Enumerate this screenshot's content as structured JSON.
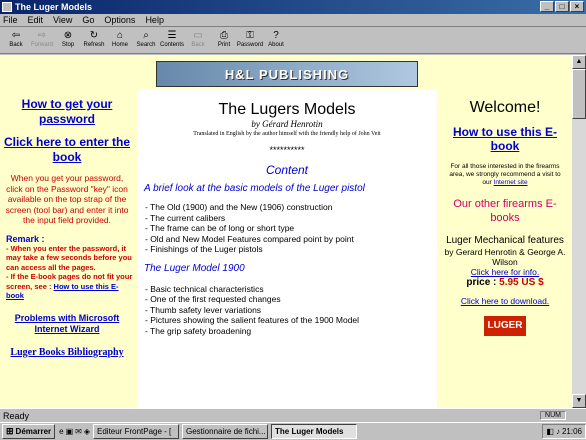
{
  "window": {
    "title": "The Luger Models"
  },
  "menu": [
    "File",
    "Edit",
    "View",
    "Go",
    "Options",
    "Help"
  ],
  "toolbar": [
    {
      "label": "Back",
      "icon": "back-icon",
      "glyph": "⇦",
      "enabled": true
    },
    {
      "label": "Forward",
      "icon": "forward-icon",
      "glyph": "⇨",
      "enabled": false
    },
    {
      "label": "Stop",
      "icon": "stop-icon",
      "glyph": "⊗",
      "enabled": true
    },
    {
      "label": "Refresh",
      "icon": "refresh-icon",
      "glyph": "↻",
      "enabled": true
    },
    {
      "label": "Home",
      "icon": "home-icon",
      "glyph": "⌂",
      "enabled": true
    },
    {
      "label": "Search",
      "icon": "search-icon",
      "glyph": "⌕",
      "enabled": true
    },
    {
      "label": "Contents",
      "icon": "contents-icon",
      "glyph": "☰",
      "enabled": true
    },
    {
      "label": "Back",
      "icon": "back-page-icon",
      "glyph": "▭",
      "enabled": false
    },
    {
      "label": "Print",
      "icon": "print-icon",
      "glyph": "⎙",
      "enabled": true
    },
    {
      "label": "Password",
      "icon": "key-icon",
      "glyph": "⚿",
      "enabled": true
    },
    {
      "label": "About",
      "icon": "about-icon",
      "glyph": "?",
      "enabled": true
    }
  ],
  "banner": "H&L PUBLISHING",
  "left": {
    "password_link": "How to get your password",
    "enter_link": "Click here to enter the book",
    "info": "When you get your password, click on the Password \"key\" icon available on the top strap of the screen (tool bar) and enter it into the input field provided.",
    "remark_title": "Remark :",
    "remark1": "- When you enter the password, it may take a few seconds before you can access all the pages.",
    "remark2": "- If the E-book pages do not fit your screen, see : ",
    "remark2_link": "How to use this E-book",
    "problems_link": "Problems with Microsoft Internet Wizard",
    "biblio_link": "Luger Books Bibliography"
  },
  "main": {
    "title": "The Lugers Models",
    "author": "by Gérard Henrotin",
    "translation": "Translated in English by the author himself with the friendly help of John Veit",
    "stars": "**********",
    "content_heading": "Content",
    "section1": "A brief look at the basic models of the Luger pistol",
    "list1": [
      "- The Old (1900) and the New (1906) construction",
      "- The current calibers",
      "- The frame can be of long or short type",
      "- Old and New Model Features compared point by point",
      "- Finishings of the Luger pistols"
    ],
    "section2": "The Luger Model 1900",
    "list2": [
      "- Basic technical characteristics",
      "- One of the first requested changes",
      "- Thumb safety lever variations",
      "- Pictures showing the salient features of the 1900 Model",
      "- The grip safety broadening"
    ]
  },
  "right": {
    "welcome": "Welcome!",
    "howto_link": "How to use this E-book",
    "interest": "For all those interested in the firearms area, we strongly recommend a visit to our ",
    "interest_link": "Internet site",
    "other_heading": "Our other firearms E-books",
    "book_title": "Luger Mechanical features",
    "book_author": "by Gerard Henrotin & George A. Wilson",
    "info_link": "Click here for info.",
    "price_label": "price : ",
    "price": "5.95 US $",
    "download_link": "Click here to download.",
    "cover_text": "LUGER"
  },
  "status": {
    "text": "Ready",
    "num": "NUM"
  },
  "taskbar": {
    "start": "Démarrer",
    "tasks": [
      {
        "label": "Editeur FrontPage - [",
        "active": false
      },
      {
        "label": "Gestionnaire de fichi...",
        "active": false
      },
      {
        "label": "The Luger Models",
        "active": true
      }
    ],
    "clock": "21:06"
  },
  "colors": {
    "title": "#0a246a",
    "link": "#0000cc",
    "warning": "#cc0000",
    "page": "#ffffcc"
  }
}
